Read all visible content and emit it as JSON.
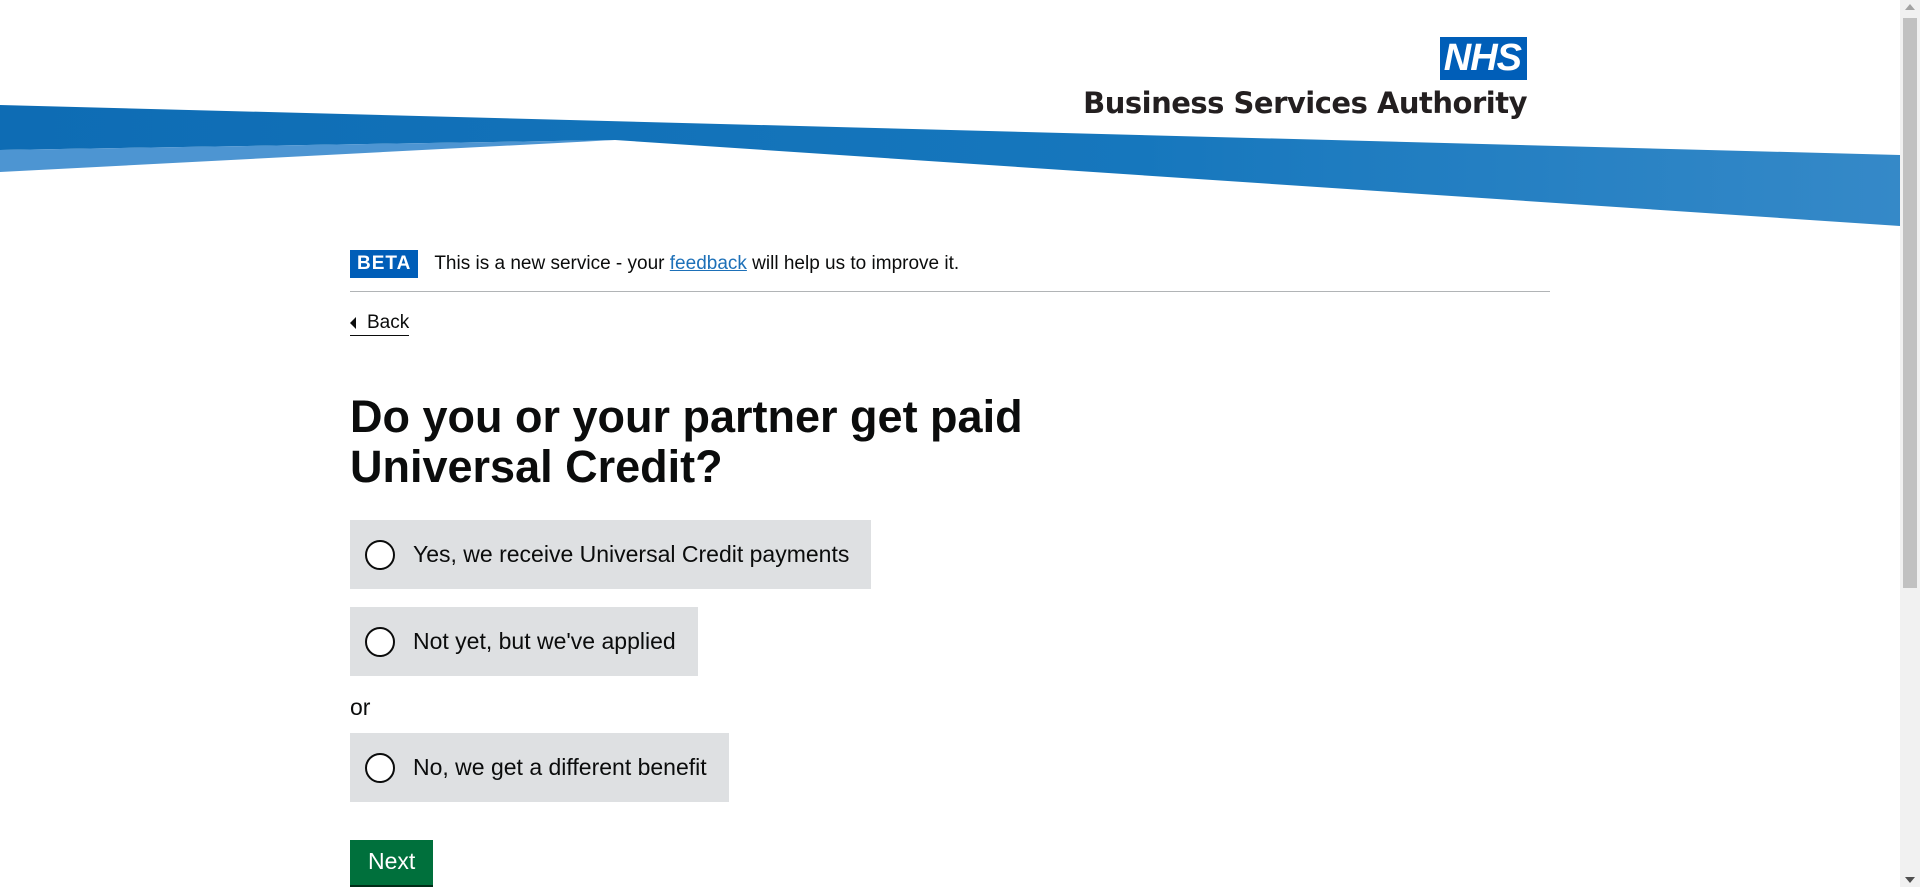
{
  "header": {
    "logo_nhs": "NHS",
    "logo_org": "Business Services Authority",
    "colors": {
      "nhs_blue": "#005eb8",
      "swoosh_dark": "#0f6db5",
      "swoosh_light": "#4a90d0"
    }
  },
  "phase_banner": {
    "tag": "BETA",
    "text_before": "This is a new service - your ",
    "link": "feedback",
    "text_after": " will help us to improve it."
  },
  "back_link": {
    "label": "Back",
    "icon": "triangle-left-icon"
  },
  "question": {
    "title": "Do you or your partner get paid Universal Credit?"
  },
  "options": [
    {
      "label": "Yes, we receive Universal Credit payments",
      "selected": false
    },
    {
      "label": "Not yet, but we've applied",
      "selected": false
    },
    {
      "label": "No, we get a different benefit",
      "selected": false
    }
  ],
  "or_divider": "or",
  "next_button": {
    "label": "Next",
    "color": "#00703c"
  }
}
